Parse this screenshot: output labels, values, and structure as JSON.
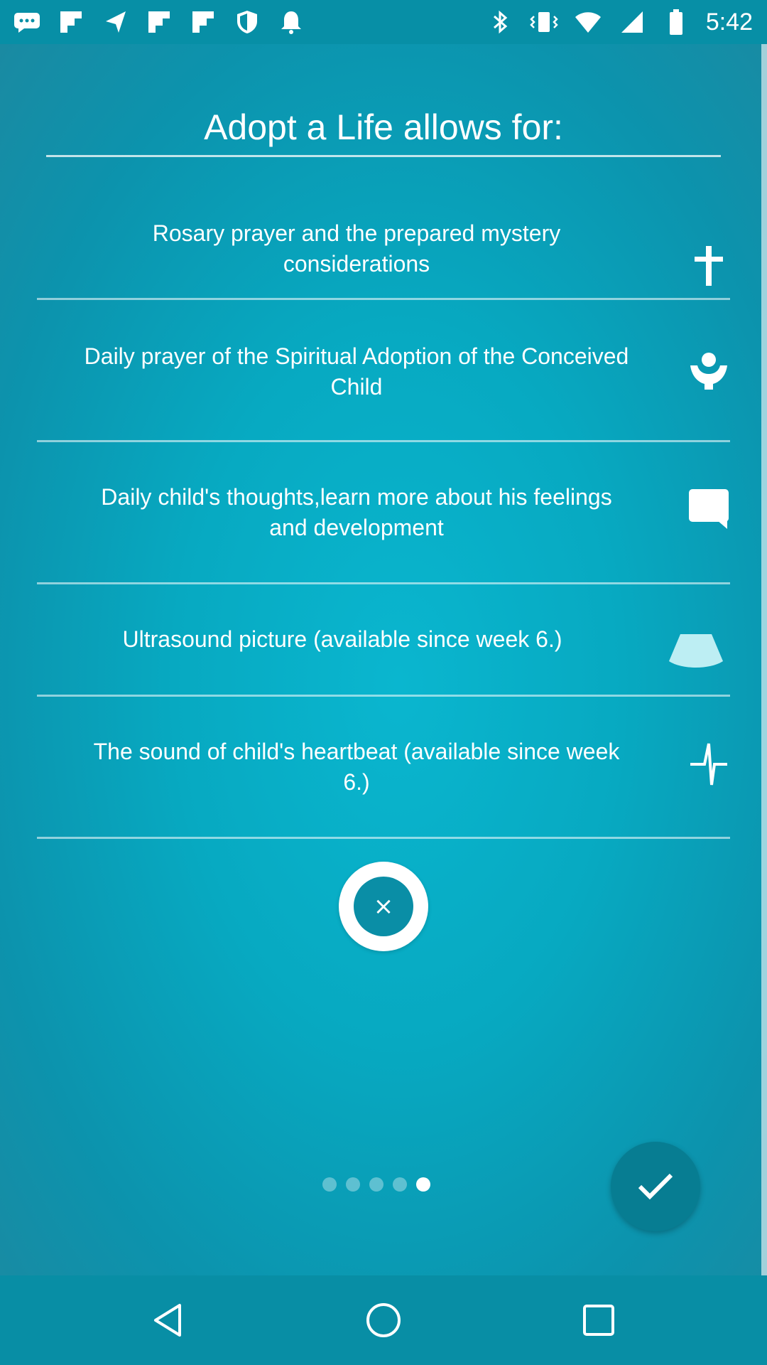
{
  "status_bar": {
    "time": "5:42",
    "left_icons": [
      "chat-icon",
      "flipboard-icon",
      "navigation-icon",
      "flipboard-icon",
      "flipboard-icon",
      "shield-icon",
      "bell-icon"
    ],
    "right_icons": [
      "bluetooth-icon",
      "vibrate-icon",
      "wifi-icon",
      "signal-icon",
      "battery-icon"
    ]
  },
  "heading": "Adopt a Life allows for:",
  "features": [
    {
      "text": "Rosary prayer and the prepared mystery considerations",
      "icon": "cross-icon"
    },
    {
      "text": "Daily prayer of the Spiritual Adoption of the Conceived Child",
      "icon": "praying-person-icon"
    },
    {
      "text": "Daily child's thoughts,learn more about his feelings and development",
      "icon": "speech-bubble-icon"
    },
    {
      "text": "Ultrasound picture (available since week 6.)",
      "icon": "ultrasound-icon"
    },
    {
      "text": "The sound of child's heartbeat (available since week 6.)",
      "icon": "heartbeat-icon"
    }
  ],
  "dismiss_button": {
    "label": "×"
  },
  "pagination": {
    "total": 5,
    "current": 5
  },
  "confirm_button": {
    "icon": "checkmark-icon"
  },
  "nav_bar": {
    "buttons": [
      "back-icon",
      "home-icon",
      "recents-icon"
    ]
  },
  "colors": {
    "status_bar": "#078fa6",
    "background": "#07a9c1",
    "confirm_button": "#077d92",
    "nav_bar": "#088ea5",
    "text": "#ffffff"
  }
}
